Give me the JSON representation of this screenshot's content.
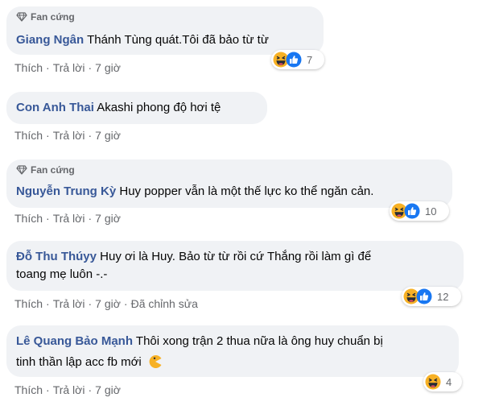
{
  "comments": [
    {
      "badge": "Fan cứng",
      "author": "Giang Ngân",
      "text": "Thánh Tùng quát.Tôi đã bảo từ từ",
      "actions": {
        "like": "Thích",
        "reply": "Trả lời",
        "time": "7 giờ"
      },
      "reactions": {
        "icons": [
          "haha-icon",
          "like-icon"
        ],
        "count": "7"
      }
    },
    {
      "author": "Con Anh Thai",
      "text": "Akashi phong độ hơi tệ",
      "actions": {
        "like": "Thích",
        "reply": "Trả lời",
        "time": "7 giờ"
      }
    },
    {
      "badge": "Fan cứng",
      "author": "Nguyễn Trung Kỳ",
      "text": "Huy popper vẫn là một thế lực ko thể ngăn cản.",
      "actions": {
        "like": "Thích",
        "reply": "Trả lời",
        "time": "7 giờ"
      },
      "reactions": {
        "icons": [
          "haha-icon",
          "like-icon"
        ],
        "count": "10"
      }
    },
    {
      "author": "Đỗ Thu Thúyy",
      "text_line1": "Huy ơi là Huy. Bảo từ từ rồi cứ Thắng rồi làm gì để",
      "text_line2": "toang mẹ luôn -.-",
      "actions": {
        "like": "Thích",
        "reply": "Trả lời",
        "time": "7 giờ",
        "edited": "Đã chỉnh sửa"
      },
      "reactions": {
        "icons": [
          "haha-icon",
          "like-icon"
        ],
        "count": "12"
      }
    },
    {
      "author": "Lê Quang Bảo Mạnh",
      "text_line1": "Thôi xong trận 2 thua nữa là ông huy chuẩn bị",
      "text_line2": "tinh thần lập acc fb mới",
      "inline_icon": "pacman-emoticon-icon",
      "actions": {
        "like": "Thích",
        "reply": "Trả lời",
        "time": "7 giờ"
      },
      "reactions": {
        "icons": [
          "haha-icon"
        ],
        "count": "4"
      }
    }
  ],
  "colors": {
    "author": "#385898",
    "bubble": "#f0f2f5",
    "meta": "#65676b",
    "like_blue": "#1877f2",
    "haha_yellow": "#f7b125"
  }
}
